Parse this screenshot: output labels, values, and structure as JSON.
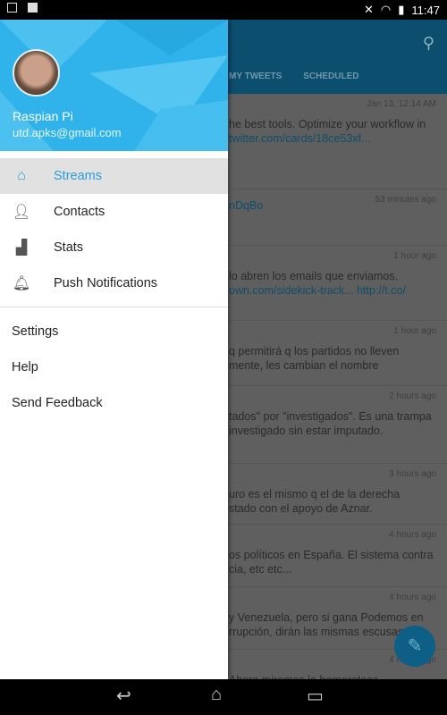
{
  "status_bar": {
    "time": "11:47",
    "icons": [
      "image-icon",
      "clipboard-check-icon",
      "mute-icon",
      "wifi-icon",
      "battery-icon"
    ]
  },
  "background": {
    "tabs": [
      "MY TWEETS",
      "SCHEDULED"
    ],
    "tweets": [
      {
        "time": "Jan 13, 12:14 AM",
        "line1": "he best tools. Optimize your workflow in",
        "line2": "twitter.com/cards/18ce53xf..."
      },
      {
        "time": "53 minutes ago",
        "line1": "",
        "line2": "nDqBo"
      },
      {
        "time": "1 hour ago",
        "line1": "lo abren los emails que enviamos.",
        "line2": "own.com/sidekick-track... http://t.co/"
      },
      {
        "time": "1 hour ago",
        "line1": "q permitirá q los partidos no lleven",
        "line2": "mente, les cambian el nombre"
      },
      {
        "time": "2 hours ago",
        "line1": "tados\" por \"investigados\". Es una trampa",
        "line2": "investigado sin estar imputado."
      },
      {
        "time": "3 hours ago",
        "line1": "uro es el mismo q el de la derecha",
        "line2": "stado con el apoyo de Aznar."
      },
      {
        "time": "4 hours ago",
        "line1": "os políticos en España. El sistema contra",
        "line2": "cia, etc etc..."
      },
      {
        "time": "4 hours ago",
        "line1": "y Venezuela, pero si gana Podemos en",
        "line2": "rrupción, dirán las mismas escusas"
      },
      {
        "time": "4 hours ago",
        "line1": "Ahora miremos la hemeroteca",
        "line2": ""
      }
    ]
  },
  "drawer": {
    "user": {
      "name": "Raspian Pi",
      "email": "utd.apks@gmail.com"
    },
    "items": [
      {
        "label": "Streams",
        "icon": "home-icon",
        "selected": true
      },
      {
        "label": "Contacts",
        "icon": "person-icon"
      },
      {
        "label": "Stats",
        "icon": "bar-chart-icon"
      },
      {
        "label": "Push Notifications",
        "icon": "bell-icon"
      }
    ],
    "secondary": [
      "Settings",
      "Help",
      "Send Feedback"
    ]
  },
  "colors": {
    "accent": "#2a9ed9",
    "header": "#2fb3ea",
    "appbar": "#0b4e6d"
  }
}
